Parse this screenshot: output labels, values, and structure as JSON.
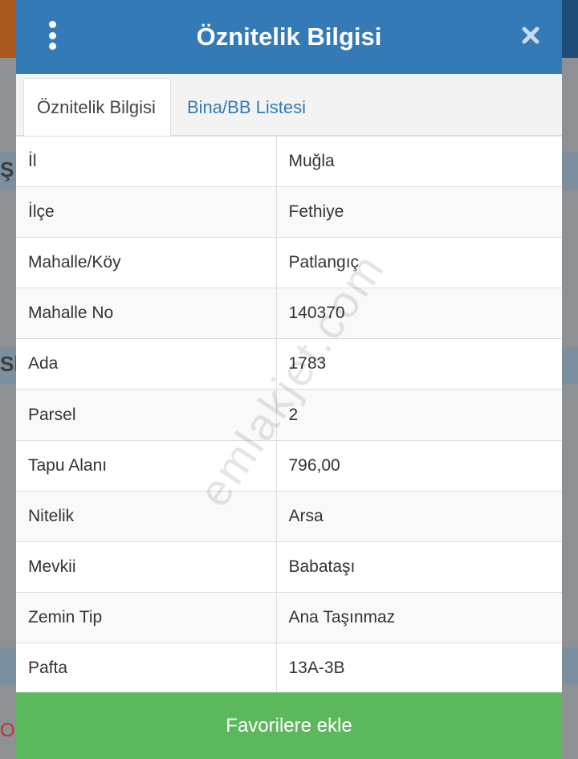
{
  "header": {
    "title": "Öznitelik Bilgisi",
    "menu_icon": "kebab-menu-icon",
    "close_icon": "close-icon"
  },
  "tabs": [
    {
      "label": "Öznitelik Bilgisi",
      "active": true
    },
    {
      "label": "Bina/BB Listesi",
      "active": false
    }
  ],
  "attributes": [
    {
      "key": "İl",
      "value": "Muğla"
    },
    {
      "key": "İlçe",
      "value": "Fethiye"
    },
    {
      "key": "Mahalle/Köy",
      "value": "Patlangıç"
    },
    {
      "key": "Mahalle No",
      "value": "140370"
    },
    {
      "key": "Ada",
      "value": "1783"
    },
    {
      "key": "Parsel",
      "value": "2"
    },
    {
      "key": "Tapu Alanı",
      "value": "796,00"
    },
    {
      "key": "Nitelik",
      "value": "Arsa"
    },
    {
      "key": "Mevkii",
      "value": "Babataşı"
    },
    {
      "key": "Zemin Tip",
      "value": "Ana Taşınmaz"
    },
    {
      "key": "Pafta",
      "value": "13A-3B"
    }
  ],
  "actions": {
    "favorite_label": "Favorilere ekle"
  },
  "watermark": "emlakjet.com",
  "background_fragments": [
    "Ş",
    "Sk",
    "O"
  ],
  "colors": {
    "header": "#337ab7",
    "tab_link": "#337ab7",
    "favorite_button": "#5cb85c"
  }
}
